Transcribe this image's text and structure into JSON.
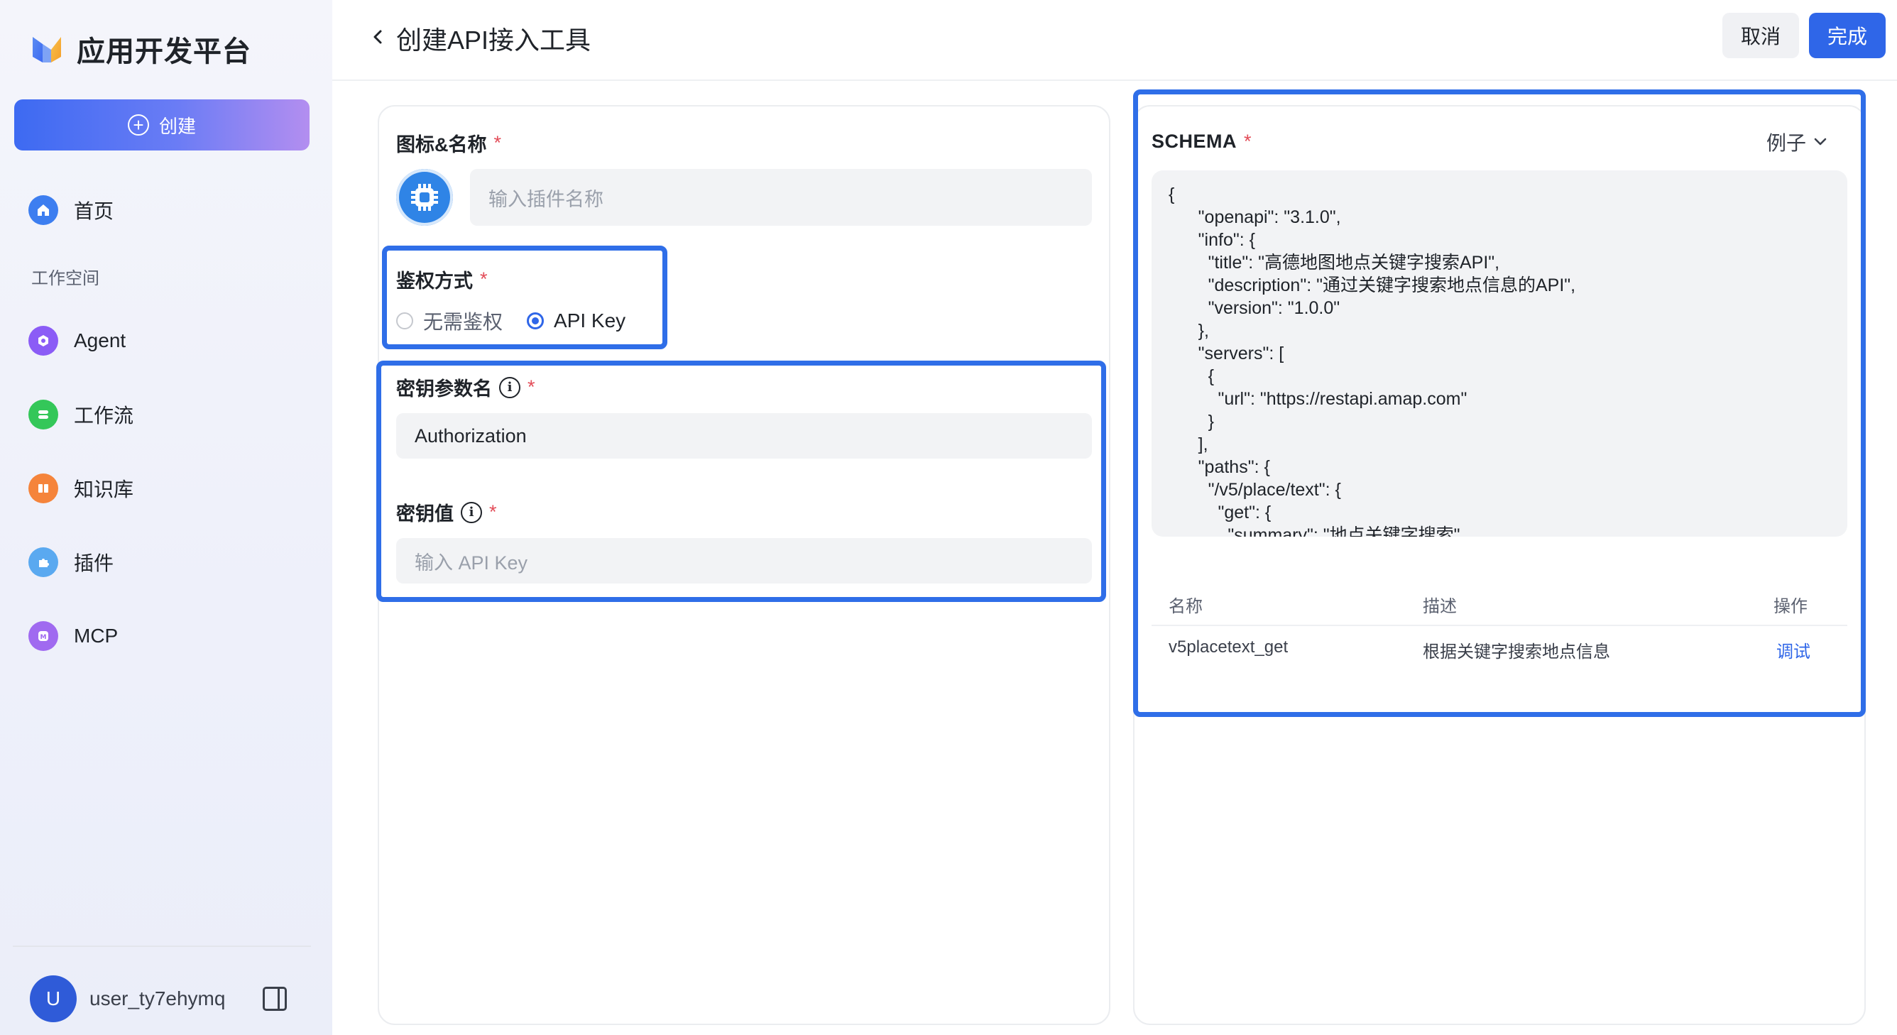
{
  "app": {
    "brand_name": "应用开发平台",
    "create_label": "创建"
  },
  "sidebar": {
    "home": "首页",
    "section_label": "工作空间",
    "items": [
      {
        "label": "Agent",
        "color": "#8b5cf6"
      },
      {
        "label": "工作流",
        "color": "#34c759"
      },
      {
        "label": "知识库",
        "color": "#f5843b"
      },
      {
        "label": "插件",
        "color": "#5aa9f0"
      },
      {
        "label": "MCP",
        "color": "#a06af0"
      }
    ],
    "username": "user_ty7ehymq",
    "avatar_letter": "U"
  },
  "header": {
    "title": "创建API接入工具",
    "cancel_label": "取消",
    "done_label": "完成"
  },
  "form": {
    "name_label": "图标&名称",
    "name_placeholder": "输入插件名称",
    "auth_label": "鉴权方式",
    "auth_options": [
      "无需鉴权",
      "API Key"
    ],
    "auth_selected": "API Key",
    "key_name_label": "密钥参数名",
    "key_name_value": "Authorization",
    "key_value_label": "密钥值",
    "key_value_placeholder": "输入 API Key",
    "required_mark": "*"
  },
  "schema": {
    "label": "SCHEMA",
    "example_label": "例子",
    "code": "{\n      \"openapi\": \"3.1.0\",\n      \"info\": {\n        \"title\": \"高德地图地点关键字搜索API\",\n        \"description\": \"通过关键字搜索地点信息的API\",\n        \"version\": \"1.0.0\"\n      },\n      \"servers\": [\n        {\n          \"url\": \"https://restapi.amap.com\"\n        }\n      ],\n      \"paths\": {\n        \"/v5/place/text\": {\n          \"get\": {\n            \"summary\": \"地点关键字搜索\","
  },
  "table": {
    "headers": [
      "名称",
      "描述",
      "操作"
    ],
    "rows": [
      {
        "name": "v5placetext_get",
        "description": "根据关键字搜索地点信息",
        "action": "调试"
      }
    ]
  }
}
